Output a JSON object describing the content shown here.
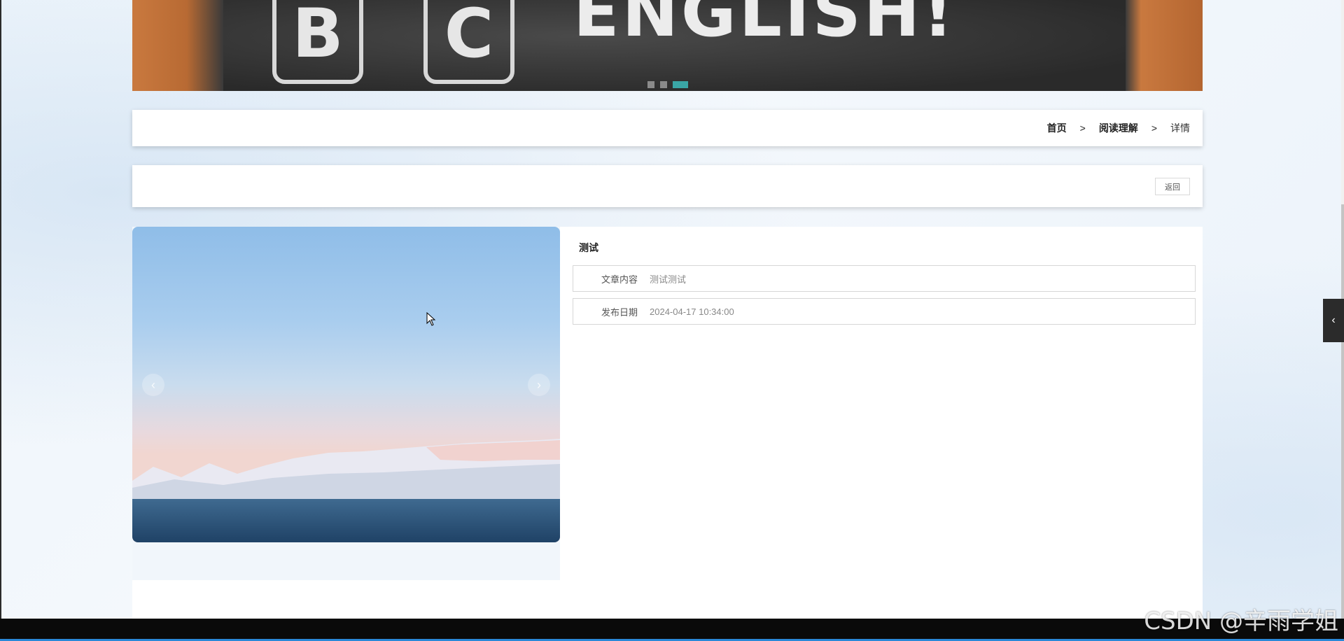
{
  "banner": {
    "letters": [
      "B",
      "C"
    ],
    "word": "ENGLISH!",
    "dots_count": 3,
    "active_dot": 3
  },
  "breadcrumb": {
    "items": [
      "首页",
      "阅读理解",
      "详情"
    ],
    "separator": ">"
  },
  "actions": {
    "back_label": "返回"
  },
  "gallery": {
    "prev_icon": "chevron-left-icon",
    "next_icon": "chevron-right-icon",
    "prev_glyph": "‹",
    "next_glyph": "›"
  },
  "detail": {
    "title": "测试",
    "fields": [
      {
        "label": "文章内容",
        "value": "测试测试"
      },
      {
        "label": "发布日期",
        "value": "2024-04-17 10:34:00"
      }
    ]
  },
  "side_tab": {
    "icon": "chevron-left-icon",
    "glyph": "‹"
  },
  "watermark": "CSDN @辛雨学姐",
  "colors": {
    "accent_dot": "#3aa6a6",
    "panel_bg": "#ffffff",
    "page_bg": "#eef5fb"
  }
}
